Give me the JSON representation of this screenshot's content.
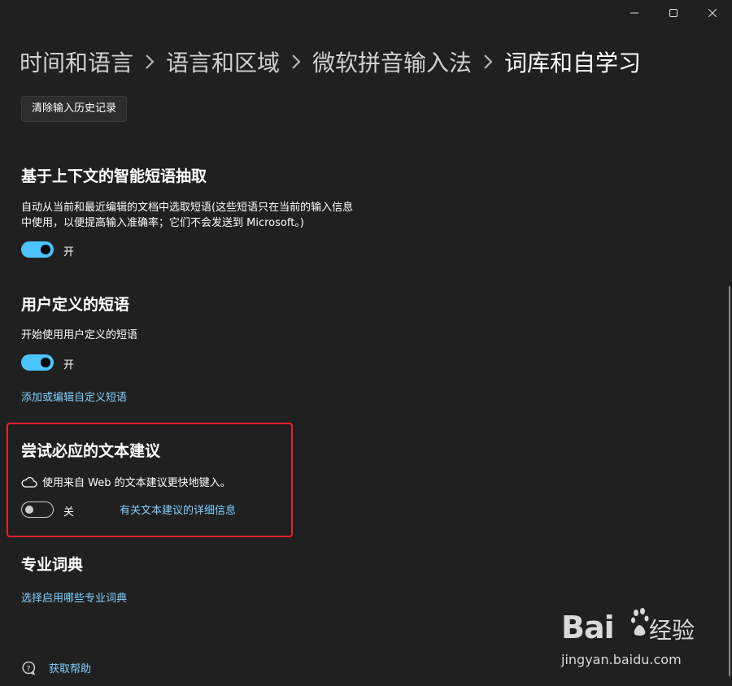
{
  "breadcrumb": {
    "items": [
      "时间和语言",
      "语言和区域",
      "微软拼音输入法",
      "词库和自学习"
    ]
  },
  "buttons": {
    "clear_history": "清除输入历史记录"
  },
  "sections": {
    "context": {
      "title": "基于上下文的智能短语抽取",
      "desc_line1": "自动从当前和最近编辑的文档中选取短语(这些短语只在当前的输入信息",
      "desc_line2": "中使用，以便提高输入准确率；它们不会发送到 Microsoft。)",
      "toggle_state": "开"
    },
    "user_phrases": {
      "title": "用户定义的短语",
      "desc": "开始使用用户定义的短语",
      "toggle_state": "开",
      "link": "添加或编辑自定义短语"
    },
    "suggestions": {
      "title": "尝试必应的文本建议",
      "desc": "使用来自 Web 的文本建议更快地键入。",
      "toggle_state": "关",
      "link": "有关文本建议的详细信息"
    },
    "dictionary": {
      "title": "专业词典",
      "link": "选择启用哪些专业词典"
    }
  },
  "help": {
    "label": "获取帮助"
  },
  "watermark": {
    "logo": "Bai",
    "cn": "经验",
    "url": "jingyan.baidu.com"
  },
  "colors": {
    "background": "#202020",
    "accent": "#4cc2ff",
    "link": "#7fd1ff",
    "highlight": "#e8222a"
  }
}
